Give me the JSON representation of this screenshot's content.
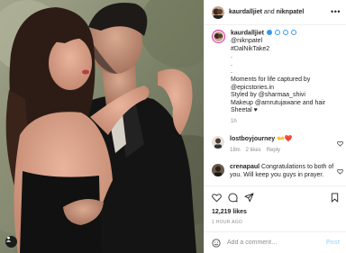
{
  "header": {
    "username": "kaurdalljiet",
    "connector": "and",
    "coauthor": "niknpatel",
    "more_label": "•••"
  },
  "caption": {
    "username": "kaurdalljiet",
    "lines": [
      "@niknpatel",
      "#DalNikTake2",
      ".",
      ".",
      ".",
      "Moments for life captured by",
      "@epicstories.in",
      "Styled by @sharmaa_shivi",
      "Makeup @amrutujawane and hair",
      "Sheetal ♥"
    ],
    "time": "1h"
  },
  "comments": [
    {
      "username": "lostboyjourney",
      "text": "👐❤️",
      "time": "18m",
      "likes": "2 likes",
      "reply": "Reply"
    },
    {
      "username": "crenapaul",
      "text": "Congratulations to both of you. Will keep you guys in prayer.",
      "time": "",
      "likes": "",
      "reply": ""
    }
  ],
  "likes": "12,219 likes",
  "post_time": "1 HOUR AGO",
  "add_comment": {
    "placeholder": "Add a comment…",
    "post_label": "Post"
  },
  "colors": {
    "verified": "#3897f0",
    "post_button": "#b2dffc",
    "heart": "#ed4956"
  },
  "icons": [
    "heart-icon",
    "comment-icon",
    "share-icon",
    "bookmark-icon",
    "emoji-icon",
    "more-icon",
    "verified-icon",
    "user-tag-icon"
  ]
}
